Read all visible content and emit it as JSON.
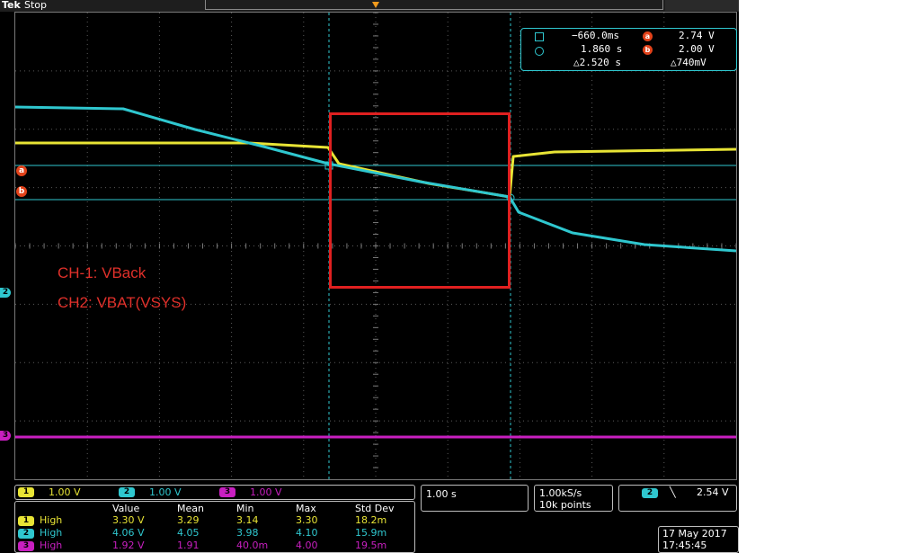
{
  "header": {
    "brand": "Tek",
    "status": "Stop"
  },
  "colors": {
    "ch1": "#e8e435",
    "ch2": "#2fc7cf",
    "ch3": "#c81fc0",
    "cursor": "#e2421a",
    "annotation": "#e02020",
    "trigger": "#f29a1c"
  },
  "readout": {
    "cursor_a_time": "−660.0ms",
    "cursor_b_time": "1.860 s",
    "delta_time": "△2.520 s",
    "cursor_a_volt": "2.74 V",
    "cursor_b_volt": "2.00 V",
    "delta_volt": "△740mV",
    "a_label": "a",
    "b_label": "b"
  },
  "markers": {
    "ch2": "2",
    "ch3": "3",
    "cursor_a": "a",
    "cursor_b": "b"
  },
  "annotations": {
    "line1": "CH-1: VBack",
    "line2": "CH2: VBAT(VSYS)"
  },
  "channels": [
    {
      "num": "1",
      "scale": "1.00 V"
    },
    {
      "num": "2",
      "scale": "1.00 V"
    },
    {
      "num": "3",
      "scale": "1.00 V"
    }
  ],
  "timebase": "1.00 s",
  "acquisition": {
    "rate": "1.00kS/s",
    "points": "10k points"
  },
  "trigger": {
    "channel": "2",
    "slope": "╲",
    "level": "2.54 V"
  },
  "measurements": {
    "headers": [
      "Value",
      "Mean",
      "Min",
      "Max",
      "Std Dev"
    ],
    "rows": [
      {
        "ch": "1",
        "name": "High",
        "value": "3.30 V",
        "mean": "3.29",
        "min": "3.14",
        "max": "3.30",
        "std": "18.2m"
      },
      {
        "ch": "2",
        "name": "High",
        "value": "4.06 V",
        "mean": "4.05",
        "min": "3.98",
        "max": "4.10",
        "std": "15.9m"
      },
      {
        "ch": "3",
        "name": "High",
        "value": "1.92 V",
        "mean": "1.91",
        "min": "40.0m",
        "max": "4.00",
        "std": "19.5m"
      }
    ]
  },
  "datetime": {
    "date": "17 May 2017",
    "time": "17:45:45"
  }
}
